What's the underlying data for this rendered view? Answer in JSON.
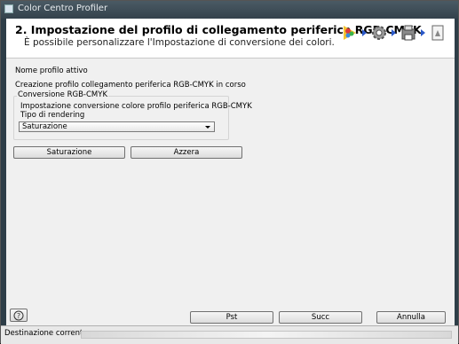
{
  "window": {
    "title": "Color Centro Profiler"
  },
  "header": {
    "title": "2. Impostazione del profilo di collegamento periferica RGB-CMYK",
    "subtitle": "È possibile personalizzare l'Impostazione di conversione dei colori.",
    "wizard_icons": [
      "target-icon",
      "gear-icon",
      "printer-icon",
      "document-icon"
    ]
  },
  "main": {
    "active_profile_label": "Nome profilo attivo",
    "status_text": "Creazione profilo collegamento periferica RGB-CMYK in corso",
    "conversion_group_title": "Conversione RGB-CMYK",
    "conversion_setting_label": "Impostazione conversione colore profilo periferica RGB-CMYK",
    "rendering_label": "Tipo di rendering",
    "rendering_value": "Saturazione",
    "saturation_button": "Saturazione",
    "reset_button": "Azzera"
  },
  "footer": {
    "help_button": "?",
    "prev_button": "Pst",
    "next_button": "Succ",
    "cancel_button": "Annulla"
  },
  "statusbar": {
    "label": "Destinazione corrente"
  }
}
